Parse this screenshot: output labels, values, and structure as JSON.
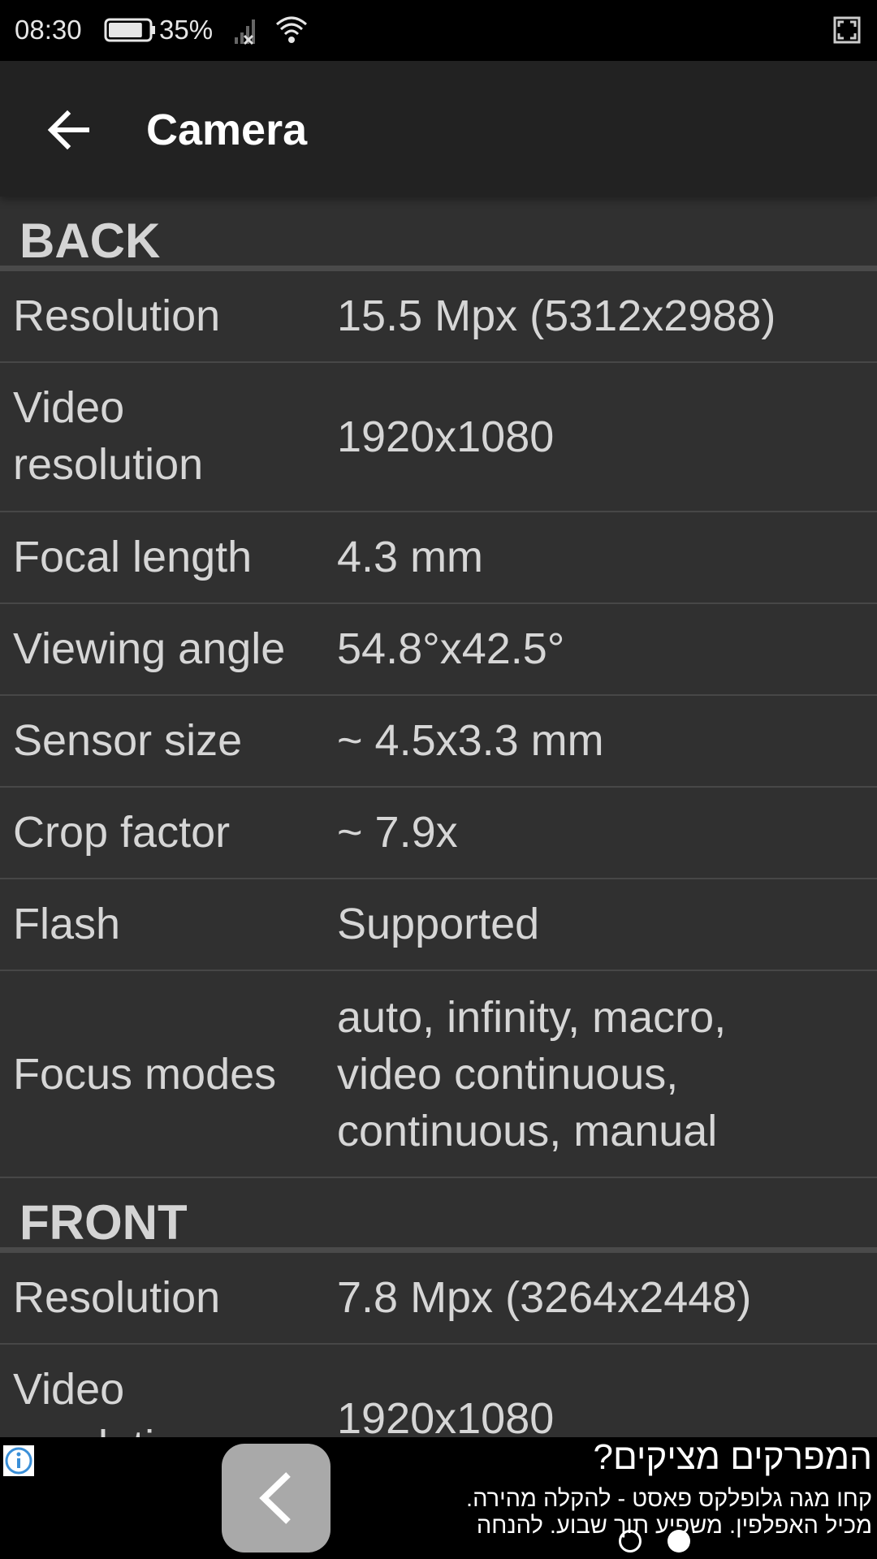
{
  "status_bar": {
    "time": "08:30",
    "battery_percent": "35%",
    "battery_level": 0.35
  },
  "app_bar": {
    "title": "Camera"
  },
  "sections": [
    {
      "header": "BACK",
      "rows": [
        {
          "label": "Resolution",
          "value": "15.5 Mpx (5312x2988)"
        },
        {
          "label": "Video resolution",
          "value": "1920x1080"
        },
        {
          "label": "Focal length",
          "value": "4.3 mm"
        },
        {
          "label": "Viewing angle",
          "value": "54.8°x42.5°"
        },
        {
          "label": "Sensor size",
          "value": "~ 4.5x3.3 mm"
        },
        {
          "label": "Crop factor",
          "value": "~ 7.9x"
        },
        {
          "label": "Flash",
          "value": "Supported"
        },
        {
          "label": "Focus modes",
          "value": "auto, infinity, macro, video continuous, continuous, manual"
        }
      ]
    },
    {
      "header": "FRONT",
      "rows": [
        {
          "label": "Resolution",
          "value": "7.8 Mpx (3264x2448)"
        },
        {
          "label": "Video resolution",
          "value": "1920x1080"
        }
      ]
    }
  ],
  "ad": {
    "headline": "המפרקים מציקים?",
    "line1": "קחו מגה גלופלקס פאסט - להקלה מהירה.",
    "line2": "מכיל האפלפין. משפיע תוך שבוע. להנחה"
  }
}
